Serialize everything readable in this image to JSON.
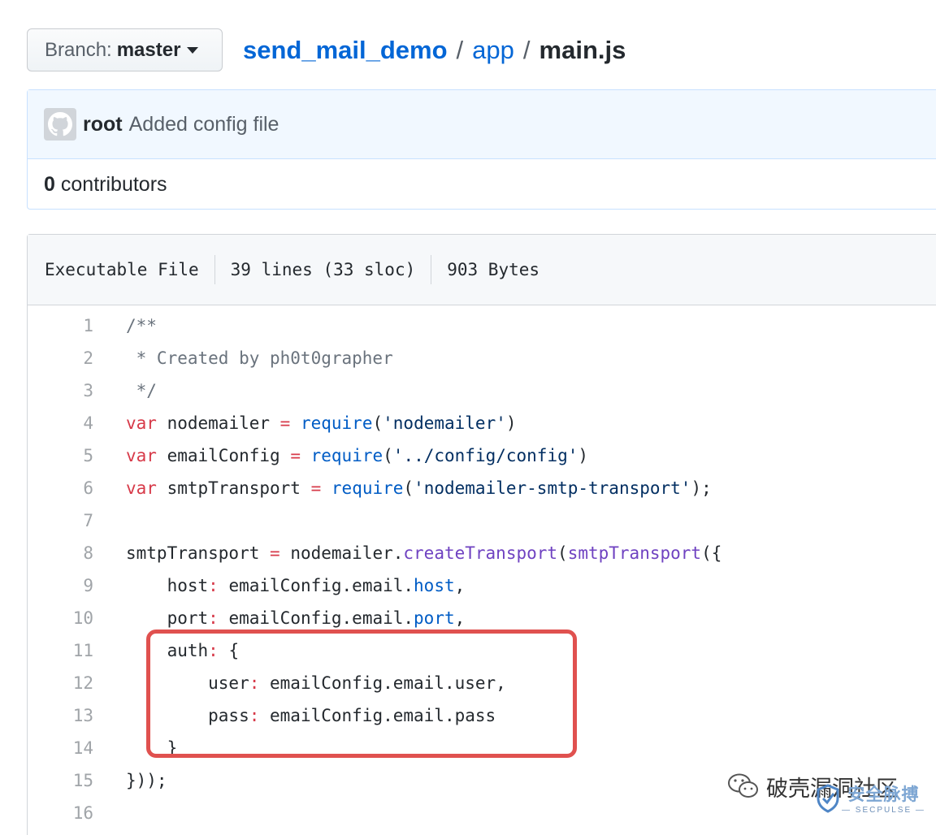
{
  "branch": {
    "label": "Branch:",
    "name": "master"
  },
  "breadcrumb": {
    "repo": "send_mail_demo",
    "sep1": "/",
    "folder": "app",
    "sep2": "/",
    "file": "main.js"
  },
  "commit": {
    "author": "root",
    "message": "Added config file"
  },
  "contributors": {
    "count": "0",
    "label": "contributors"
  },
  "file_info": {
    "mode": "Executable File",
    "lines": "39 lines (33 sloc)",
    "size": "903 Bytes"
  },
  "code": {
    "l1": "/**",
    "l2": " * Created by ph0t0grapher",
    "l3": " */",
    "l4": {
      "kw": "var",
      "name": " nodemailer ",
      "op": "=",
      "fn": "require",
      "open": "(",
      "str": "'nodemailer'",
      "close": ")"
    },
    "l5": {
      "kw": "var",
      "name": " emailConfig ",
      "op": "=",
      "fn": "require",
      "open": "(",
      "str": "'../config/config'",
      "close": ")"
    },
    "l6": {
      "kw": "var",
      "name": " smtpTransport ",
      "op": "=",
      "fn": "require",
      "open": "(",
      "str": "'nodemailer-smtp-transport'",
      "close": ");"
    },
    "l8": {
      "name": "smtpTransport ",
      "op": "=",
      "obj": " nodemailer.",
      "fn1": "createTransport",
      "open": "(",
      "fn2": "smtpTransport",
      "close": "({"
    },
    "l9": {
      "key": "    host",
      "colon": ":",
      "obj": " emailConfig.email.",
      "prop": "host",
      "end": ","
    },
    "l10": {
      "key": "    port",
      "colon": ":",
      "obj": " emailConfig.email.",
      "prop": "port",
      "end": ","
    },
    "l11": {
      "key": "    auth",
      "colon": ":",
      "rest": " {"
    },
    "l12": {
      "key": "        user",
      "colon": ":",
      "rest": " emailConfig.email.user,"
    },
    "l13": {
      "key": "        pass",
      "colon": ":",
      "rest": " emailConfig.email.pass"
    },
    "l14": "    }",
    "l15": "}));"
  },
  "line_numbers": [
    "1",
    "2",
    "3",
    "4",
    "5",
    "6",
    "7",
    "8",
    "9",
    "10",
    "11",
    "12",
    "13",
    "14",
    "15",
    "16"
  ],
  "watermark": {
    "text": "破壳漏洞社区",
    "logo_big": "安全脉搏",
    "logo_small": "— SECPULSE —"
  },
  "colors": {
    "link": "#0366d6",
    "highlight_box": "#e0514f",
    "keyword": "#d73a49",
    "string": "#032f62"
  }
}
